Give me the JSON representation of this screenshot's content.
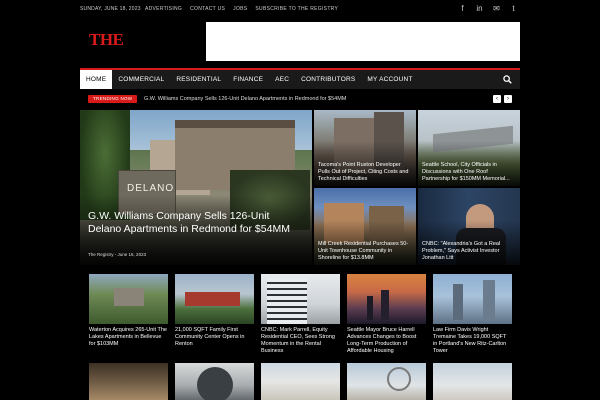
{
  "topbar": {
    "date": "SUNDAY, JUNE 18, 2023",
    "links": [
      "ADVERTISING",
      "CONTACT US",
      "JOBS",
      "SUBSCRIBE TO THE REGISTRY"
    ],
    "social_icons": [
      "facebook-icon",
      "linkedin-icon",
      "email-icon",
      "twitter-icon"
    ]
  },
  "header": {
    "logo_text": "THE",
    "brand_color": "#d91a1a"
  },
  "nav": {
    "items": [
      "HOME",
      "COMMERCIAL",
      "RESIDENTIAL",
      "FINANCE",
      "AEC",
      "CONTRIBUTORS",
      "MY ACCOUNT"
    ],
    "active": "HOME"
  },
  "ticker": {
    "tag": "TRENDING NOW",
    "headline": "G.W. Williams Company Sells 126-Unit Delano Apartments in Redmond for $54MM"
  },
  "hero": {
    "sign_text": "DELANO",
    "title": "G.W. Williams Company Sells 126-Unit Delano Apartments in Redmond for $54MM",
    "author": "The Registry",
    "separator": "-",
    "date": "June 16, 2023"
  },
  "tiles": [
    {
      "title": "Tacoma's Point Ruston Developer Pulls Out of Project, Citing Costs and Technical Difficulties"
    },
    {
      "title": "Seattle School, City Officials in Discussions with One Roof Partnership for $150MM Memorial..."
    },
    {
      "title": "Mill Creek Residential Purchases 50-Unit Townhouse Community in Shoreline for $13.8MM"
    },
    {
      "title": "CNBC: \"Alexandria's Got a Real Problem,\" Says Activist Investor Jonathan Litt"
    }
  ],
  "cards": [
    {
      "title": "Waterton Acquires 265-Unit The Lakes Apartments in Bellevue for $103MM"
    },
    {
      "title": "21,000 SQFT Family First Community Center Opens in Renton"
    },
    {
      "title": "CNBC: Mark Parrell, Equity Residential CEO, Sees Strong Momentum in the Rental Business"
    },
    {
      "title": "Seattle Mayor Bruce Harrell Advances Changes to Boost Long-Term Production of Affordable Housing"
    },
    {
      "title": "Law Firm Davis Wright Tremaine Takes 19,000 SQFT in Portland's New Ritz-Carlton Tower"
    }
  ]
}
